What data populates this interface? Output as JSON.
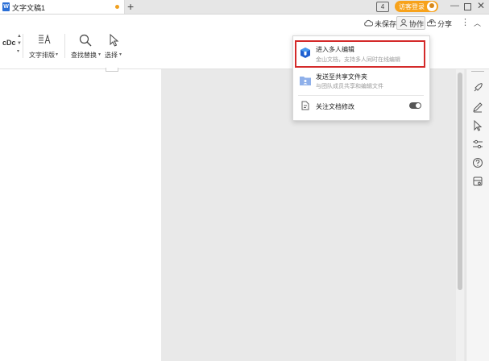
{
  "tab": {
    "title": "文字文稿1",
    "doc_icon_letter": "W"
  },
  "titlebar": {
    "badge": "4",
    "login": "访客登录"
  },
  "toolbar": {
    "unsaved": "未保存",
    "collab": "协作",
    "share": "分享",
    "styles_preview": "cDc",
    "text_layout": "文字排版",
    "find_replace": "查找替换",
    "select": "选择"
  },
  "menu": {
    "items": [
      {
        "title": "进入多人编辑",
        "subtitle": "金山文档，支持多人同时在线编辑"
      },
      {
        "title": "发送至共享文件夹",
        "subtitle": "与团队成员共享和编辑文件"
      },
      {
        "title": "关注文档修改",
        "toggle": "on"
      }
    ]
  },
  "colors": {
    "accent": "#f7a21b",
    "highlight": "#d42a2a",
    "doc_blue": "#2b6fd6"
  }
}
